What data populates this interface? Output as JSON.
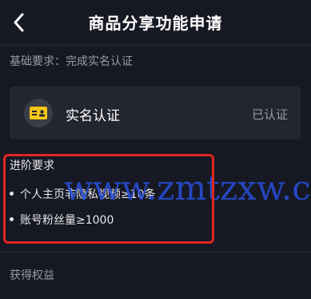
{
  "header": {
    "title": "商品分享功能申请",
    "back_icon": "chevron-left-icon"
  },
  "basic": {
    "label": "基础要求：完成实名认证",
    "card": {
      "icon": "id-card-icon",
      "label": "实名认证",
      "status": "已认证"
    }
  },
  "advanced": {
    "title": "进阶要求",
    "requirements": [
      "个人主页非隐私视频≥10条",
      "账号粉丝量≥1000"
    ]
  },
  "watermark": "www.zmtzxw.com",
  "benefits": {
    "title": "获得权益"
  },
  "colors": {
    "background": "#161823",
    "card": "#23252f",
    "highlight": "#e0261f",
    "icon_accent": "#f5c518",
    "watermark": "#2850dc"
  }
}
